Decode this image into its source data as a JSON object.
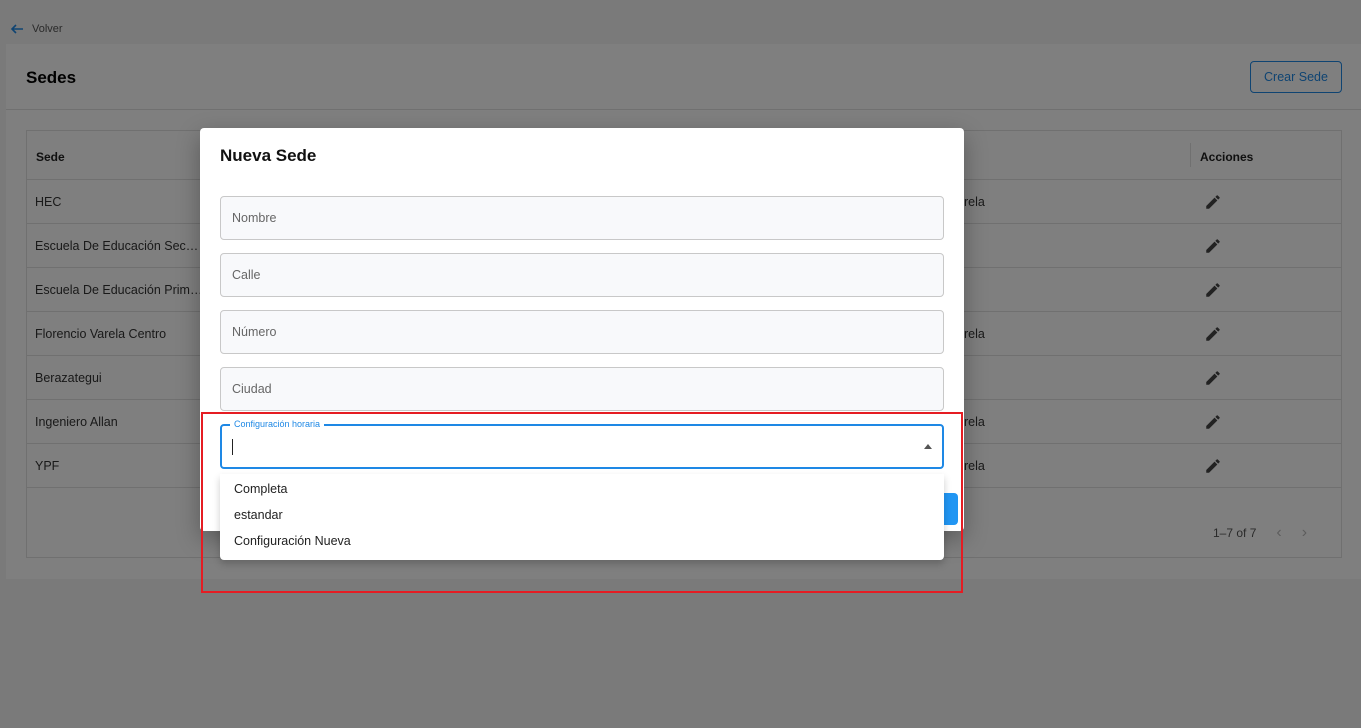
{
  "nav": {
    "back_label": "Volver"
  },
  "page": {
    "title": "Sedes",
    "create_button": "Crear Sede"
  },
  "table": {
    "headers": {
      "sede": "Sede",
      "acciones": "Acciones"
    },
    "rows": [
      {
        "sede": "HEC",
        "col3": "rela"
      },
      {
        "sede": "Escuela De Educación Secundaria",
        "col3": ""
      },
      {
        "sede": "Escuela De Educación Primaria",
        "col3": ""
      },
      {
        "sede": "Florencio Varela Centro",
        "col3": "rela"
      },
      {
        "sede": "Berazategui",
        "col3": ""
      },
      {
        "sede": "Ingeniero Allan",
        "col3": "rela"
      },
      {
        "sede": "YPF",
        "col3": "rela"
      }
    ],
    "pagination": "1–7 of 7"
  },
  "dialog": {
    "title": "Nueva Sede",
    "fields": {
      "nombre": "Nombre",
      "calle": "Calle",
      "numero": "Número",
      "ciudad": "Ciudad"
    },
    "select": {
      "label": "Configuración horaria",
      "value": "",
      "options": [
        "Completa",
        "estandar",
        "Configuración Nueva"
      ]
    }
  },
  "colors": {
    "accent": "#1e88e5",
    "highlight": "#e51c23"
  }
}
